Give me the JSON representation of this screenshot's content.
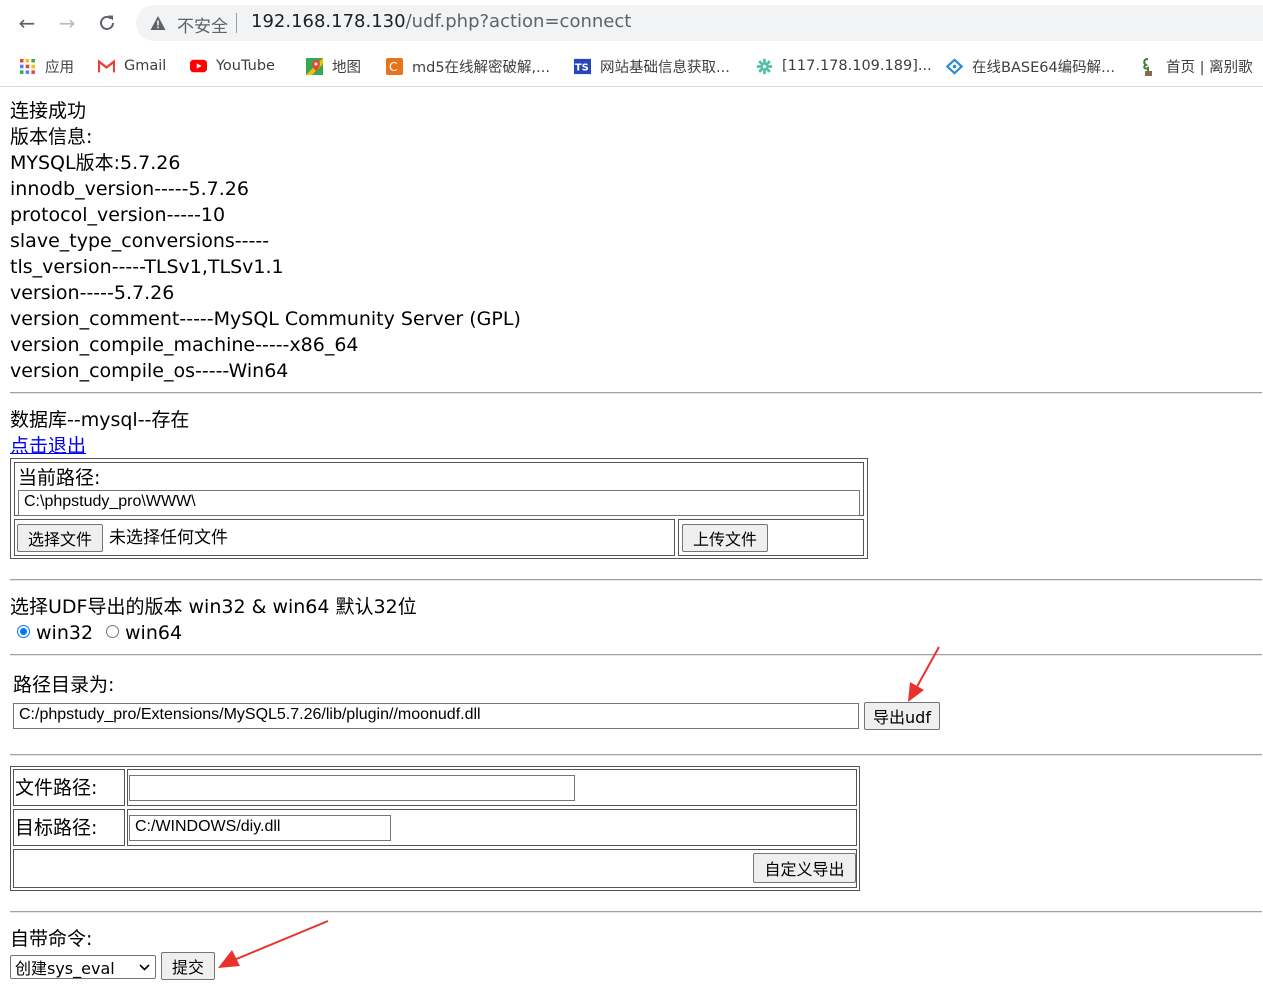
{
  "browser": {
    "insecure_label": "不安全",
    "url_host": "192.168.178.130",
    "url_path": "/udf.php?action=connect"
  },
  "bookmarks": [
    {
      "label": "应用",
      "icon": "apps-grid-icon"
    },
    {
      "label": "Gmail",
      "icon": "gmail-icon"
    },
    {
      "label": "YouTube",
      "icon": "youtube-icon"
    },
    {
      "label": "地图",
      "icon": "maps-icon"
    },
    {
      "label": "md5在线解密破解,...",
      "icon": "md5-site-icon"
    },
    {
      "label": "网站基础信息获取...",
      "icon": "ts-site-icon"
    },
    {
      "label": "[117.178.109.189]...",
      "icon": "gear-site-icon"
    },
    {
      "label": "在线BASE64编码解...",
      "icon": "base64-site-icon"
    },
    {
      "label": "首页 | 离别歌",
      "icon": "plant-site-icon"
    }
  ],
  "page": {
    "status": "连接成功",
    "version_heading": "版本信息:",
    "version_lines": [
      "MYSQL版本:5.7.26",
      "innodb_version-----5.7.26",
      "protocol_version-----10",
      "slave_type_conversions-----",
      "tls_version-----TLSv1,TLSv1.1",
      "version-----5.7.26",
      "version_comment-----MySQL Community Server (GPL)",
      "version_compile_machine-----x86_64",
      "version_compile_os-----Win64"
    ],
    "db_status": "数据库--mysql--存在",
    "logout_link": "点击退出",
    "upload": {
      "path_label": "当前路径:",
      "path_value": "C:\\phpstudy_pro\\WWW\\",
      "choose_file_button": "选择文件",
      "no_file_text": "未选择任何文件",
      "upload_button": "上传文件"
    },
    "udf_version": {
      "label": "选择UDF导出的版本 win32 & win64 默认32位",
      "options": [
        {
          "label": "win32",
          "checked": true
        },
        {
          "label": "win64",
          "checked": false
        }
      ]
    },
    "export": {
      "path_label": "路径目录为:",
      "path_value": "C:/phpstudy_pro/Extensions/MySQL5.7.26/lib/plugin//moonudf.dll",
      "export_button": "导出udf"
    },
    "custom_export": {
      "file_path_label": "文件路径:",
      "file_path_value": "",
      "target_path_label": "目标路径:",
      "target_path_value": "C:/WINDOWS/diy.dll",
      "export_button": "自定义导出"
    },
    "command": {
      "label": "自带命令:",
      "selected_option": "创建sys_eval",
      "submit_button": "提交"
    },
    "annotation_color": "#e8322e"
  }
}
